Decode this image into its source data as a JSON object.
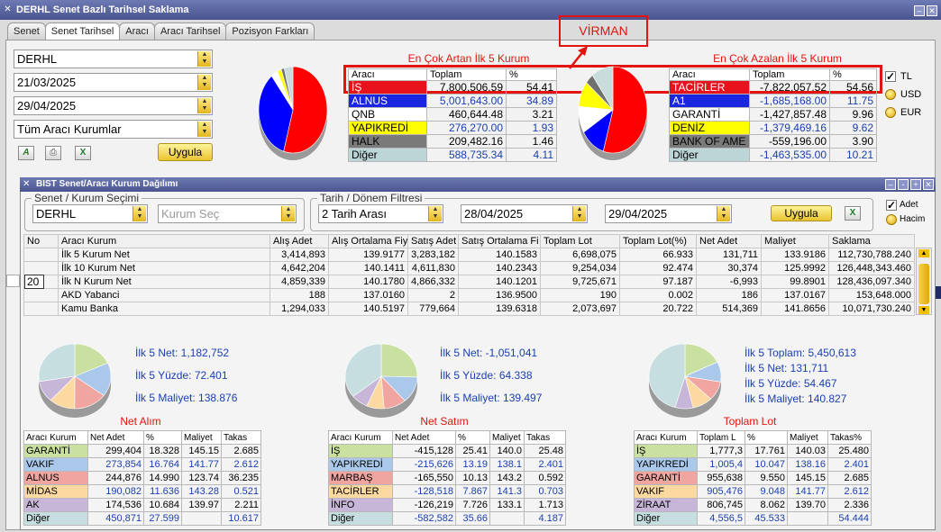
{
  "window": {
    "title": "DERHL Senet Bazlı Tarihsel Saklama"
  },
  "tabs": [
    {
      "label": "Senet"
    },
    {
      "label": "Senet Tarihsel"
    },
    {
      "label": "Aracı"
    },
    {
      "label": "Aracı Tarihsel"
    },
    {
      "label": "Pozisyon Farkları"
    }
  ],
  "filters": {
    "symbol": "DERHL",
    "start_date": "21/03/2025",
    "end_date": "29/04/2025",
    "broker_filter": "Tüm Aracı Kurumlar",
    "apply_label": "Uygula"
  },
  "annotation": {
    "label": "VİRMAN"
  },
  "top_gainers": {
    "title": "En Çok Artan İlk 5 Kurum",
    "headers": [
      "Aracı",
      "Toplam",
      "%"
    ],
    "rows": [
      {
        "name": "İŞ",
        "total": "7,800,506.59",
        "pct": "54.41",
        "bg": "#e8121c",
        "fg": "#ffffff"
      },
      {
        "name": "ALNUS",
        "total": "5,001,643.00",
        "pct": "34.89",
        "bg": "#1a26e0",
        "fg": "#ffffff"
      },
      {
        "name": "QNB",
        "total": "460,644.48",
        "pct": "3.21",
        "bg": "#ffffff",
        "fg": "#000000"
      },
      {
        "name": "YAPIKREDİ",
        "total": "276,270.00",
        "pct": "1.93",
        "bg": "#ffff00",
        "fg": "#000000"
      },
      {
        "name": "HALK",
        "total": "209,482.16",
        "pct": "1.46",
        "bg": "#7a7a7a",
        "fg": "#000000"
      },
      {
        "name": "Diğer",
        "total": "588,735.34",
        "pct": "4.11",
        "bg": "#bcd6d8",
        "fg": "#000000"
      }
    ],
    "pie": [
      54.41,
      34.89,
      3.21,
      1.93,
      1.46,
      4.11
    ]
  },
  "top_losers": {
    "title": "En Çok Azalan İlk 5 Kurum",
    "headers": [
      "Aracı",
      "Toplam",
      "%"
    ],
    "rows": [
      {
        "name": "TACİRLER",
        "total": "-7,822,057.52",
        "pct": "54.56",
        "bg": "#e8121c",
        "fg": "#ffffff"
      },
      {
        "name": "A1",
        "total": "-1,685,168.00",
        "pct": "11.75",
        "bg": "#1a26e0",
        "fg": "#ffffff"
      },
      {
        "name": "GARANTİ",
        "total": "-1,427,857.48",
        "pct": "9.96",
        "bg": "#ffffff",
        "fg": "#000000"
      },
      {
        "name": "DENİZ",
        "total": "-1,379,469.16",
        "pct": "9.62",
        "bg": "#ffff00",
        "fg": "#000000"
      },
      {
        "name": "BANK OF AME",
        "total": "-559,196.00",
        "pct": "3.90",
        "bg": "#7a7a7a",
        "fg": "#000000"
      },
      {
        "name": "Diğer",
        "total": "-1,463,535.00",
        "pct": "10.21",
        "bg": "#bcd6d8",
        "fg": "#000000"
      }
    ],
    "pie": [
      54.56,
      11.75,
      9.96,
      9.62,
      3.9,
      10.21
    ]
  },
  "currency": {
    "options": [
      "TL",
      "USD",
      "EUR"
    ],
    "selected": "TL"
  },
  "subwindow": {
    "title": "BIST Senet/Aracı Kurum Dağılımı",
    "stock_group": {
      "legend": "Senet / Kurum Seçimi",
      "symbol": "DERHL",
      "broker_placeholder": "Kurum Seç"
    },
    "date_group": {
      "legend": "Tarih / Dönem Filtresi",
      "mode": "2 Tarih Arası",
      "from": "28/04/2025",
      "to": "29/04/2025",
      "apply_label": "Uygula"
    },
    "mode_options": [
      "Adet",
      "Hacim"
    ],
    "row_input": "20",
    "table": {
      "headers": [
        "No",
        "Aracı Kurum",
        "Alış Adet",
        "Alış Ortalama Fiy",
        "Satış Adet",
        "Satış Ortalama Fi",
        "Toplam Lot",
        "Toplam Lot(%)",
        "Net Adet",
        "Maliyet",
        "Saklama"
      ],
      "rows": [
        [
          "",
          "İlk 5 Kurum Net",
          "3,414,893",
          "139.9177",
          "3,283,182",
          "140.1583",
          "6,698,075",
          "66.933",
          "131,711",
          "133.9186",
          "112,730,788.240"
        ],
        [
          "",
          "İlk 10 Kurum Net",
          "4,642,204",
          "140.1411",
          "4,611,830",
          "140.2343",
          "9,254,034",
          "92.474",
          "30,374",
          "125.9992",
          "126,448,343.460"
        ],
        [
          "",
          "İlk N Kurum Net",
          "4,859,339",
          "140.1780",
          "4,866,332",
          "140.1201",
          "9,725,671",
          "97.187",
          "-6,993",
          "99.8901",
          "128,436,097.340"
        ],
        [
          "",
          "AKD Yabanci",
          "188",
          "137.0160",
          "2",
          "136.9500",
          "190",
          "0.002",
          "186",
          "137.0167",
          "153,648.000"
        ],
        [
          "",
          "Kamu Banka",
          "1,294,033",
          "140.5197",
          "779,664",
          "139.6318",
          "2,073,697",
          "20.722",
          "514,369",
          "141.8656",
          "10,071,730.240"
        ]
      ]
    },
    "stats": [
      {
        "lines": [
          "İlk 5 Net: 1,182,752",
          "İlk 5 Yüzde: 72.401",
          "İlk 5 Maliyet: 138.876"
        ]
      },
      {
        "lines": [
          "İlk 5 Net: -1,051,041",
          "İlk 5 Yüzde: 64.338",
          "İlk 5 Maliyet: 139.497"
        ]
      },
      {
        "lines": [
          "İlk 5 Toplam: 5,450,613",
          "İlk 5 Net: 131,711",
          "İlk 5 Yüzde: 54.467",
          "İlk 5 Maliyet: 140.827"
        ]
      }
    ],
    "small_tables": [
      {
        "title": "Net Alım",
        "headers": [
          "Aracı Kurum",
          "Net Adet",
          "%",
          "Maliyet",
          "Takas"
        ],
        "rows": [
          {
            "c": [
              "GARANTİ",
              "299,404",
              "18.328",
              "145.15",
              "2.685"
            ],
            "bg": "#c9e0a0",
            "blue": false
          },
          {
            "c": [
              "VAKIF",
              "273,854",
              "16.764",
              "141.77",
              "2.612"
            ],
            "bg": "#a9c8ea",
            "blue": true
          },
          {
            "c": [
              "ALNUS",
              "244,876",
              "14.990",
              "123.74",
              "36.235"
            ],
            "bg": "#f0a5a0",
            "blue": false
          },
          {
            "c": [
              "MİDAS",
              "190,082",
              "11.636",
              "143.28",
              "0.521"
            ],
            "bg": "#fcd9a0",
            "blue": true
          },
          {
            "c": [
              "AK",
              "174,536",
              "10.684",
              "139.97",
              "2.211"
            ],
            "bg": "#c8b6d8",
            "blue": false
          },
          {
            "c": [
              "Diğer",
              "450,871",
              "27.599",
              "",
              "10.617"
            ],
            "bg": "#c6dee0",
            "blue": true
          }
        ],
        "pie": [
          18.328,
          16.764,
          14.99,
          11.636,
          10.684,
          27.599
        ]
      },
      {
        "title": "Net Satım",
        "headers": [
          "Aracı Kurum",
          "Net Adet",
          "%",
          "Maliyet",
          "Takas"
        ],
        "rows": [
          {
            "c": [
              "İŞ",
              "-415,128",
              "25.41",
              "140.0",
              "25.48"
            ],
            "bg": "#c9e0a0",
            "blue": false
          },
          {
            "c": [
              "YAPIKREDİ",
              "-215,626",
              "13.19",
              "138.1",
              "2.401"
            ],
            "bg": "#a9c8ea",
            "blue": true
          },
          {
            "c": [
              "MARBAŞ",
              "-165,550",
              "10.13",
              "143.2",
              "0.592"
            ],
            "bg": "#f0a5a0",
            "blue": false
          },
          {
            "c": [
              "TACİRLER",
              "-128,518",
              "7.867",
              "141.3",
              "0.703"
            ],
            "bg": "#fcd9a0",
            "blue": true
          },
          {
            "c": [
              "İNFO",
              "-126,219",
              "7.726",
              "133.1",
              "1.713"
            ],
            "bg": "#c8b6d8",
            "blue": false
          },
          {
            "c": [
              "Diğer",
              "-582,582",
              "35.66",
              "",
              "4.187"
            ],
            "bg": "#c6dee0",
            "blue": true
          }
        ],
        "pie": [
          25.41,
          13.19,
          10.13,
          7.867,
          7.726,
          35.66
        ]
      },
      {
        "title": "Toplam Lot",
        "headers": [
          "Aracı Kurum",
          "Toplam L",
          "%",
          "Maliyet",
          "Takas%"
        ],
        "rows": [
          {
            "c": [
              "İŞ",
              "1,777,3",
              "17.761",
              "140.03",
              "25.480"
            ],
            "bg": "#c9e0a0",
            "blue": false
          },
          {
            "c": [
              "YAPIKREDİ",
              "1,005,4",
              "10.047",
              "138.16",
              "2.401"
            ],
            "bg": "#a9c8ea",
            "blue": true
          },
          {
            "c": [
              "GARANTİ",
              "955,638",
              "9.550",
              "145.15",
              "2.685"
            ],
            "bg": "#f0a5a0",
            "blue": false
          },
          {
            "c": [
              "VAKIF",
              "905,476",
              "9.048",
              "141.77",
              "2.612"
            ],
            "bg": "#fcd9a0",
            "blue": true
          },
          {
            "c": [
              "ZİRAAT",
              "806,745",
              "8.062",
              "139.70",
              "2.336"
            ],
            "bg": "#c8b6d8",
            "blue": false
          },
          {
            "c": [
              "Diğer",
              "4,556,5",
              "45.533",
              "",
              "54.444"
            ],
            "bg": "#c6dee0",
            "blue": true
          }
        ],
        "pie": [
          17.761,
          10.047,
          9.55,
          9.048,
          8.062,
          45.533
        ]
      }
    ]
  }
}
